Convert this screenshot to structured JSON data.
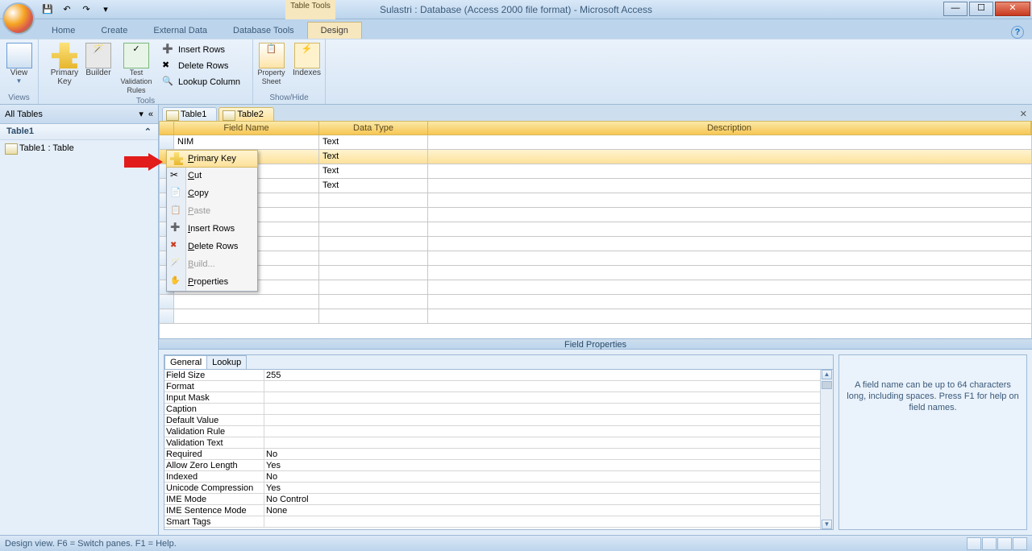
{
  "title": "Sulastri : Database (Access 2000 file format) - Microsoft Access",
  "tabletools_label": "Table Tools",
  "ribbon_tabs": [
    "Home",
    "Create",
    "External Data",
    "Database Tools",
    "Design"
  ],
  "ribbon": {
    "views": {
      "view": "View",
      "group": "Views"
    },
    "tools": {
      "primary_key": "Primary Key",
      "builder": "Builder",
      "test_rules": "Test Validation Rules",
      "insert_rows": "Insert Rows",
      "delete_rows": "Delete Rows",
      "lookup_column": "Lookup Column",
      "group": "Tools"
    },
    "showhide": {
      "property_sheet": "Property Sheet",
      "indexes": "Indexes",
      "group": "Show/Hide"
    }
  },
  "navpane": {
    "header": "All Tables",
    "group": "Table1",
    "item": "Table1 : Table"
  },
  "doctabs": [
    "Table1",
    "Table2"
  ],
  "grid": {
    "headers": {
      "field_name": "Field Name",
      "data_type": "Data Type",
      "description": "Description"
    },
    "rows": [
      {
        "fn": "NIM",
        "dt": "Text"
      },
      {
        "fn": "",
        "dt": "Text"
      },
      {
        "fn": "",
        "dt": "Text"
      },
      {
        "fn": "",
        "dt": "Text"
      }
    ]
  },
  "context_menu": [
    {
      "label": "Primary Key",
      "hi": true,
      "ic": "key"
    },
    {
      "label": "Cut",
      "ic": "scissors"
    },
    {
      "label": "Copy",
      "ic": "copy"
    },
    {
      "label": "Paste",
      "ic": "paste",
      "dis": true
    },
    {
      "label": "Insert Rows",
      "ic": "ins"
    },
    {
      "label": "Delete Rows",
      "ic": "del"
    },
    {
      "label": "Build...",
      "ic": "build",
      "dis": true
    },
    {
      "label": "Properties",
      "ic": "prop"
    }
  ],
  "field_properties": {
    "title": "Field Properties",
    "tabs": [
      "General",
      "Lookup"
    ],
    "rows": [
      {
        "k": "Field Size",
        "v": "255"
      },
      {
        "k": "Format",
        "v": ""
      },
      {
        "k": "Input Mask",
        "v": ""
      },
      {
        "k": "Caption",
        "v": ""
      },
      {
        "k": "Default Value",
        "v": ""
      },
      {
        "k": "Validation Rule",
        "v": ""
      },
      {
        "k": "Validation Text",
        "v": ""
      },
      {
        "k": "Required",
        "v": "No"
      },
      {
        "k": "Allow Zero Length",
        "v": "Yes"
      },
      {
        "k": "Indexed",
        "v": "No"
      },
      {
        "k": "Unicode Compression",
        "v": "Yes"
      },
      {
        "k": "IME Mode",
        "v": "No Control"
      },
      {
        "k": "IME Sentence Mode",
        "v": "None"
      },
      {
        "k": "Smart Tags",
        "v": ""
      }
    ],
    "help": "A field name can be up to 64 characters long, including spaces.  Press F1 for help on field names."
  },
  "status": "Design view.  F6 = Switch panes.  F1 = Help."
}
